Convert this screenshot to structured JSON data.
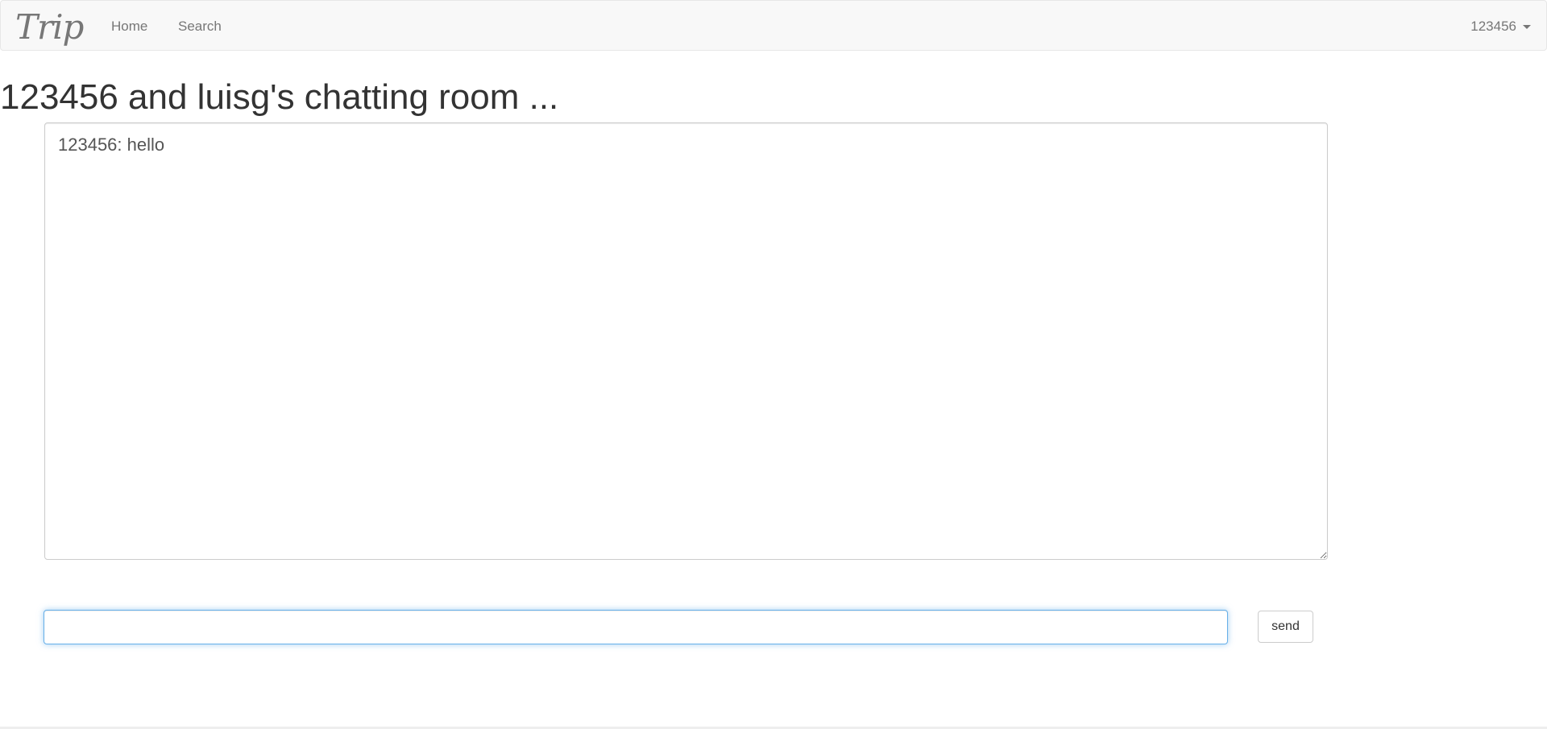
{
  "navbar": {
    "brand": "Trip",
    "links": [
      {
        "label": "Home"
      },
      {
        "label": "Search"
      }
    ],
    "user": {
      "label": "123456",
      "icon": "caret-down-icon"
    }
  },
  "page": {
    "title": "123456 and luisg's chatting room ..."
  },
  "chat": {
    "log": "123456: hello",
    "input_value": "",
    "input_placeholder": "",
    "send_label": "send"
  },
  "colors": {
    "navbar_bg": "#f8f8f8",
    "nav_text": "#777777",
    "focus_border": "#66afe9",
    "text": "#333333"
  }
}
